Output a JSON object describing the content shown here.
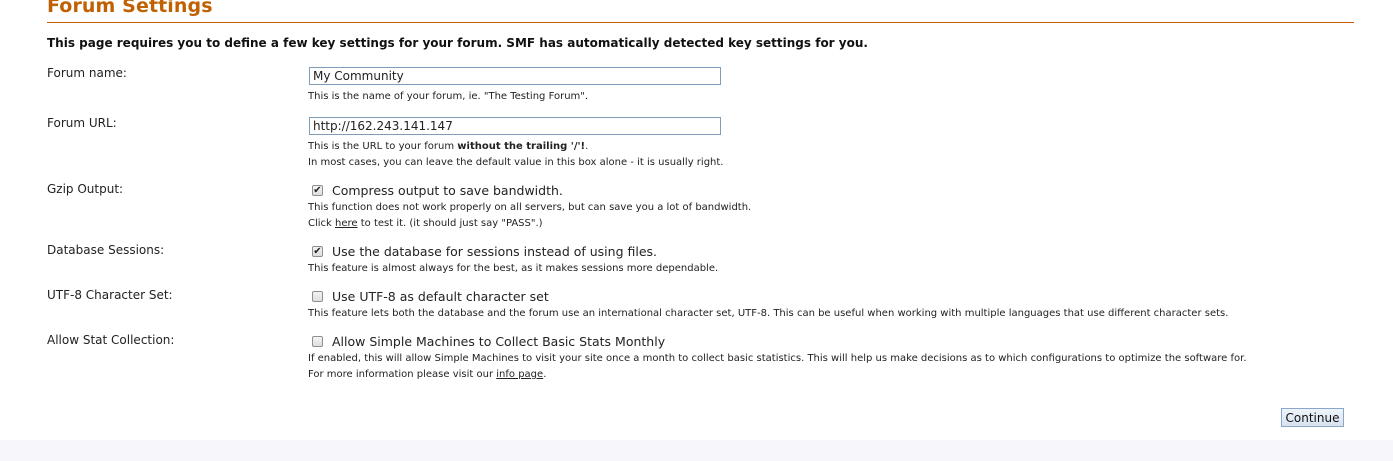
{
  "title": "Forum Settings",
  "intro": "This page requires you to define a few key settings for your forum. SMF has automatically detected key settings for you.",
  "forum_name": {
    "label": "Forum name:",
    "value": "My Community",
    "hint": "This is the name of your forum, ie. \"The Testing Forum\"."
  },
  "forum_url": {
    "label": "Forum URL:",
    "value": "http://162.243.141.147",
    "hint_prefix": "This is the URL to your forum ",
    "hint_bold": "without the trailing '/'!",
    "hint_suffix": ".",
    "hint2": "In most cases, you can leave the default value in this box alone - it is usually right."
  },
  "gzip": {
    "label": "Gzip Output:",
    "checked": true,
    "option": "Compress output to save bandwidth.",
    "hint1": "This function does not work properly on all servers, but can save you a lot of bandwidth.",
    "hint2_prefix": "Click ",
    "hint2_link": "here",
    "hint2_suffix": " to test it. (it should just say \"PASS\".)"
  },
  "db_sessions": {
    "label": "Database Sessions:",
    "checked": true,
    "option": "Use the database for sessions instead of using files.",
    "hint": "This feature is almost always for the best, as it makes sessions more dependable."
  },
  "utf8": {
    "label": "UTF-8 Character Set:",
    "checked": false,
    "option": "Use UTF-8 as default character set",
    "hint": "This feature lets both the database and the forum use an international character set, UTF-8. This can be useful when working with multiple languages that use different character sets."
  },
  "stats": {
    "label": "Allow Stat Collection:",
    "checked": false,
    "option": "Allow Simple Machines to Collect Basic Stats Monthly",
    "hint1": "If enabled, this will allow Simple Machines to visit your site once a month to collect basic statistics. This will help us make decisions as to which configurations to optimize the software for.",
    "hint2_prefix": "For more information please visit our ",
    "hint2_link": "info page",
    "hint2_suffix": "."
  },
  "continue_label": "Continue",
  "icons": {
    "checked": "checkmark-icon"
  },
  "colors": {
    "title": "#c06000",
    "input_border": "#7f9db9"
  }
}
